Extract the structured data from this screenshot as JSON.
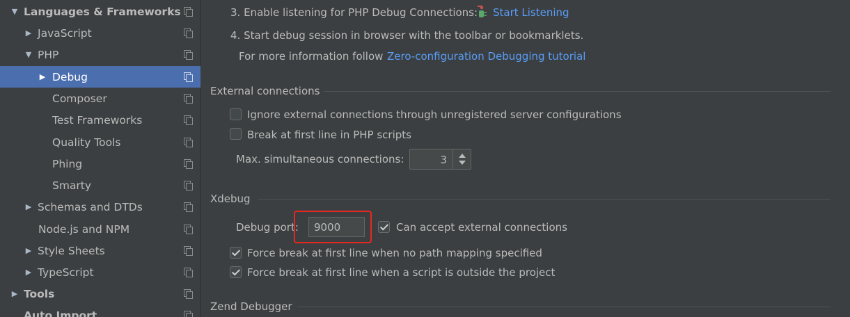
{
  "sidebar": {
    "items": [
      {
        "label": "Languages & Frameworks",
        "arrow": "▼"
      },
      {
        "label": "JavaScript",
        "arrow": "▶"
      },
      {
        "label": "PHP",
        "arrow": "▼"
      },
      {
        "label": "Debug",
        "arrow": "▶"
      },
      {
        "label": "Composer",
        "arrow": ""
      },
      {
        "label": "Test Frameworks",
        "arrow": ""
      },
      {
        "label": "Quality Tools",
        "arrow": ""
      },
      {
        "label": "Phing",
        "arrow": ""
      },
      {
        "label": "Smarty",
        "arrow": ""
      },
      {
        "label": "Schemas and DTDs",
        "arrow": "▶"
      },
      {
        "label": "Node.js and NPM",
        "arrow": ""
      },
      {
        "label": "Style Sheets",
        "arrow": "▶"
      },
      {
        "label": "TypeScript",
        "arrow": "▶"
      },
      {
        "label": "Tools",
        "arrow": "▶"
      },
      {
        "label": "Auto Import",
        "arrow": ""
      }
    ]
  },
  "steps": {
    "step3_text": "3. Enable listening for PHP Debug Connections:",
    "step3_link": "Start Listening",
    "step4_text": "4. Start debug session in browser with the toolbar or bookmarklets.",
    "info_text": "For more information follow",
    "info_link": "Zero-configuration Debugging tutorial"
  },
  "external": {
    "title": "External connections",
    "ignore_label": "Ignore external connections through unregistered server configurations",
    "ignore_checked": false,
    "break_label": "Break at first line in PHP scripts",
    "break_checked": false,
    "max_label": "Max. simultaneous connections:",
    "max_value": "3"
  },
  "xdebug": {
    "title": "Xdebug",
    "port_label": "Debug port:",
    "port_value": "9000",
    "accept_label": "Can accept external connections",
    "accept_checked": true,
    "force_no_mapping_label": "Force break at first line when no path mapping specified",
    "force_no_mapping_checked": true,
    "force_outside_label": "Force break at first line when a script is outside the project",
    "force_outside_checked": true
  },
  "zend": {
    "title": "Zend Debugger"
  },
  "colors": {
    "background": "#3c3f41",
    "selection": "#4b6eaf",
    "link": "#589df6",
    "highlight_box": "#e8281e"
  }
}
